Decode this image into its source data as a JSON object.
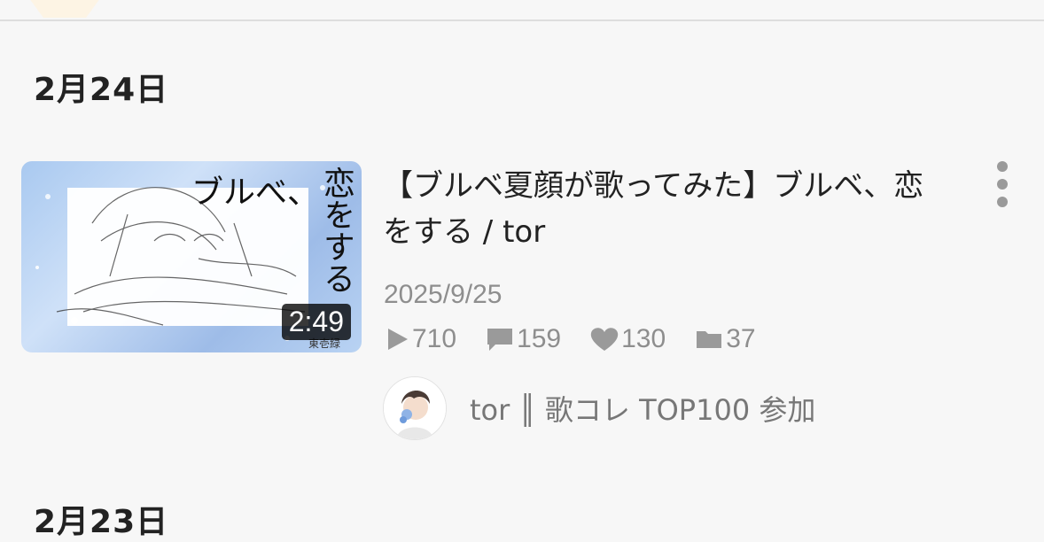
{
  "sections": [
    {
      "date": "2月24日",
      "videos": [
        {
          "thumbnail_title": "ブルべ、",
          "thumbnail_title_vertical": "恋をする",
          "duration": "2:49",
          "title": "【ブルベ夏顔が歌ってみた】ブルベ、恋をする / tor",
          "upload_date": "2025/9/25",
          "stats": {
            "views": "710",
            "comments": "159",
            "likes": "130",
            "mylists": "37"
          },
          "channel": {
            "name": "tor ║ 歌コレ TOP100 参加"
          }
        }
      ]
    },
    {
      "date": "2月23日"
    }
  ],
  "icons": {
    "views": "play-icon",
    "comments": "comment-icon",
    "likes": "heart-icon",
    "mylists": "folder-icon",
    "menu": "more-vertical-icon"
  },
  "colors": {
    "background": "#f7f7f7",
    "muted_text": "#8e8e8e",
    "icon_gray": "#9a9a9a"
  }
}
